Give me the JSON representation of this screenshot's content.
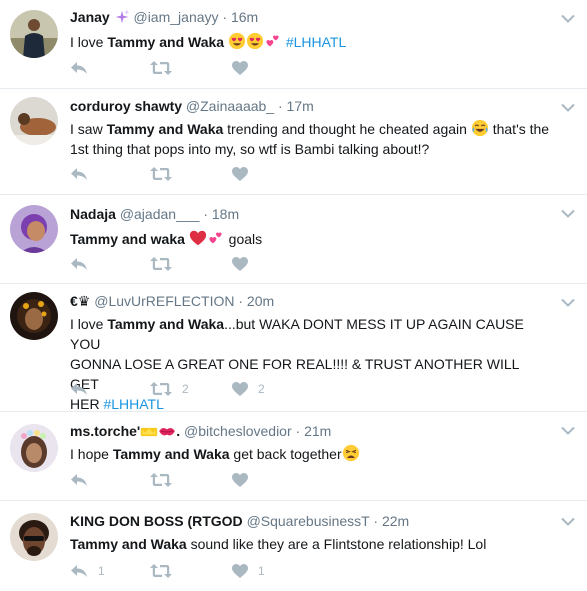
{
  "colors": {
    "name": "#14171a",
    "meta": "#657786",
    "hashtag": "#1b95e0",
    "icon": "#aab8c2",
    "divider": "#e6ecf0"
  },
  "tweets": [
    {
      "name": "Janay",
      "name_badge": "sparkles-emoji",
      "handle": "@iam_janayy",
      "sep": "·",
      "time": "16m",
      "text": [
        {
          "t": "I love ",
          "b": false
        },
        {
          "t": "Tammy and Waka",
          "b": true
        },
        {
          "t": " ",
          "b": false
        }
      ],
      "emojis_after": [
        "heart-eyes-emoji",
        "heart-eyes-emoji",
        "two-hearts-emoji"
      ],
      "hashtag": "#LHHATL",
      "reply_count": "",
      "retweet_count": "",
      "like_count": ""
    },
    {
      "name": "corduroy shawty",
      "handle": "@Zainaaaab_",
      "sep": "·",
      "time": "17m",
      "text_line1_a": "I saw ",
      "text_line1_b": "Tammy and Waka",
      "text_line1_c": " trending and thought he cheated again ",
      "text_line1_d": " that's the",
      "text_line2": "1st thing that pops into my, so wtf is Bambi talking about!?",
      "emoji_mid": "tears-of-joy-emoji",
      "reply_count": "",
      "retweet_count": "",
      "like_count": ""
    },
    {
      "name": "Nadaja",
      "handle": "@ajadan___",
      "sep": "·",
      "time": "18m",
      "text_a": "Tammy and waka",
      "text_b": " goals",
      "emojis_mid": [
        "red-heart-emoji",
        "two-hearts-emoji"
      ],
      "reply_count": "",
      "retweet_count": "",
      "like_count": ""
    },
    {
      "name": "€♛",
      "handle": "@LuvUrREFLECTION",
      "sep": "·",
      "time": "20m",
      "text_line1_a": "I love ",
      "text_line1_b": "Tammy and Waka",
      "text_line1_c": "...but WAKA DONT MESS IT UP AGAIN CAUSE YOU",
      "text_line2": "GONNA LOSE A GREAT ONE FOR REAL!!!! & TRUST ANOTHER WILL GET",
      "text_line3": "HER ",
      "hashtag": "#LHHATL",
      "reply_count": "",
      "retweet_count": "2",
      "like_count": "2"
    },
    {
      "name": "ms.torche'",
      "name_suffix": ".",
      "name_emojis": [
        "crown-emoji",
        "kiss-mark-emoji"
      ],
      "handle": "@bitcheslovedior",
      "sep": "·",
      "time": "21m",
      "text_a": "I hope ",
      "text_b": "Tammy and Waka",
      "text_c": " get back together",
      "emoji_end": "weary-face-emoji",
      "reply_count": "",
      "retweet_count": "",
      "like_count": ""
    },
    {
      "name": "KING DON BOSS (RTGOD",
      "handle": "@SquarebusinessT",
      "sep": "·",
      "time": "22m",
      "text_a": "Tammy and Waka",
      "text_b": " sound like they are a Flintstone relationship! Lol",
      "reply_count": "1",
      "retweet_count": "",
      "like_count": "1"
    }
  ]
}
